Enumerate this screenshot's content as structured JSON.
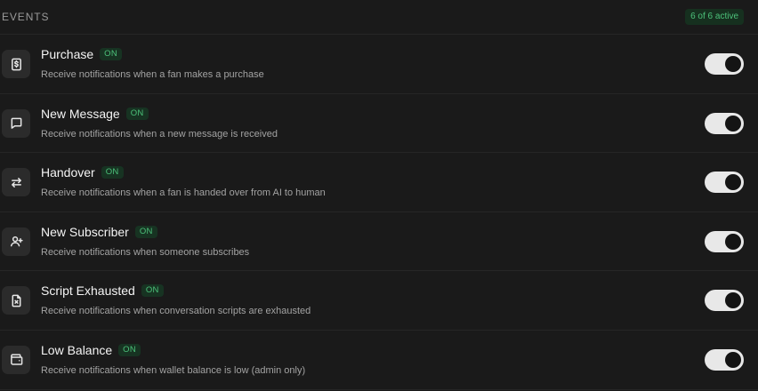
{
  "header": {
    "title": "EVENTS",
    "count_badge": "6 of 6 active"
  },
  "events": [
    {
      "icon": "dollar-receipt-icon",
      "title": "Purchase",
      "badge": "ON",
      "description": "Receive notifications when a fan makes a purchase",
      "enabled": true
    },
    {
      "icon": "message-bubble-icon",
      "title": "New Message",
      "badge": "ON",
      "description": "Receive notifications when a new message is received",
      "enabled": true
    },
    {
      "icon": "arrows-swap-icon",
      "title": "Handover",
      "badge": "ON",
      "description": "Receive notifications when a fan is handed over from AI to human",
      "enabled": true
    },
    {
      "icon": "user-plus-icon",
      "title": "New Subscriber",
      "badge": "ON",
      "description": "Receive notifications when someone subscribes",
      "enabled": true
    },
    {
      "icon": "file-x-icon",
      "title": "Script Exhausted",
      "badge": "ON",
      "description": "Receive notifications when conversation scripts are exhausted",
      "enabled": true
    },
    {
      "icon": "wallet-icon",
      "title": "Low Balance",
      "badge": "ON",
      "description": "Receive notifications when wallet balance is low (admin only)",
      "enabled": true
    }
  ],
  "colors": {
    "background": "#1a1a1a",
    "accent_green": "#4cc17a",
    "toggle_on": "#e8e8e8"
  }
}
